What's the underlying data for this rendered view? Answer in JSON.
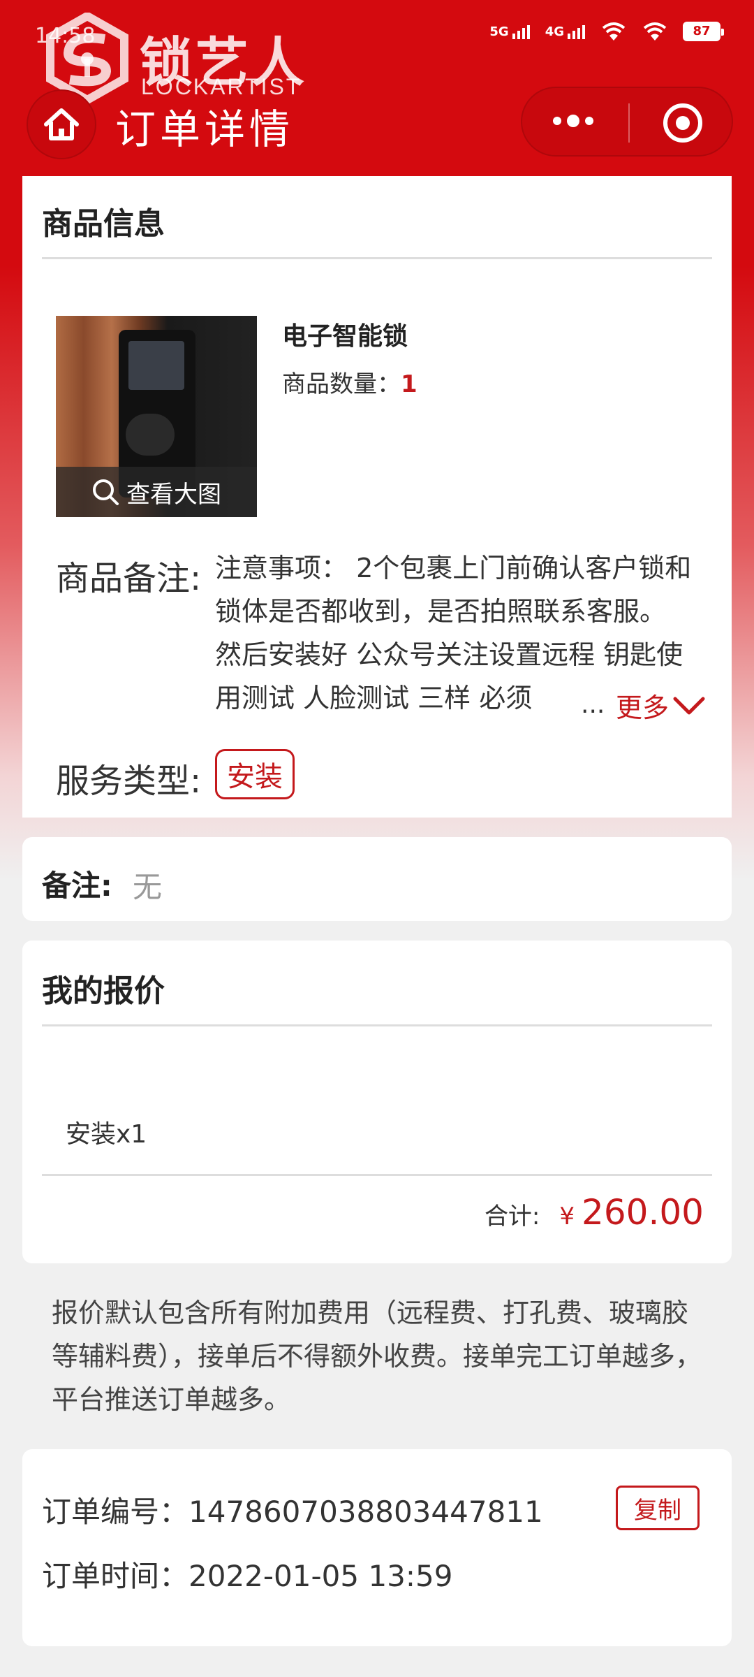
{
  "status_bar": {
    "time": "14:58",
    "network_1": "5G",
    "network_2": "4G",
    "battery": "87"
  },
  "logo": {
    "name_cn": "锁艺人",
    "name_en": "LOCKARTIST"
  },
  "nav": {
    "title": "订单详情"
  },
  "product_card": {
    "title": "商品信息",
    "view_image_label": "查看大图",
    "product_name": "电子智能锁",
    "quantity_label": "商品数量：",
    "quantity_value": "1",
    "remark_label": "商品备注:",
    "remark_text": "注意事项： 2个包裹上门前确认客户锁和锁体是否都收到，是否拍照联系客服。 然后安装好 公众号关注设置远程 钥匙使用测试 人脸测试 三样 必须",
    "ellipsis": "...",
    "more_label": "更多",
    "service_type_label": "服务类型:",
    "service_type_value": "安装"
  },
  "note_card": {
    "label": "备注:",
    "value": "无"
  },
  "quote_card": {
    "title": "我的报价",
    "items": [
      "安装x1"
    ],
    "total_label": "合计:",
    "currency": "¥",
    "total_amount": "260.00"
  },
  "notice": "报价默认包含所有附加费用（远程费、打孔费、玻璃胶等辅料费），接单后不得额外收费。接单完工订单越多，平台推送订单越多。",
  "order_card": {
    "order_no_label": "订单编号：",
    "order_no_value": "1478607038803447811",
    "copy_label": "复制",
    "order_time_label": "订单时间：",
    "order_time_value": "2022-01-05 13:59"
  },
  "colors": {
    "brand_red": "#d40a0f",
    "accent_red": "#c4191c"
  }
}
